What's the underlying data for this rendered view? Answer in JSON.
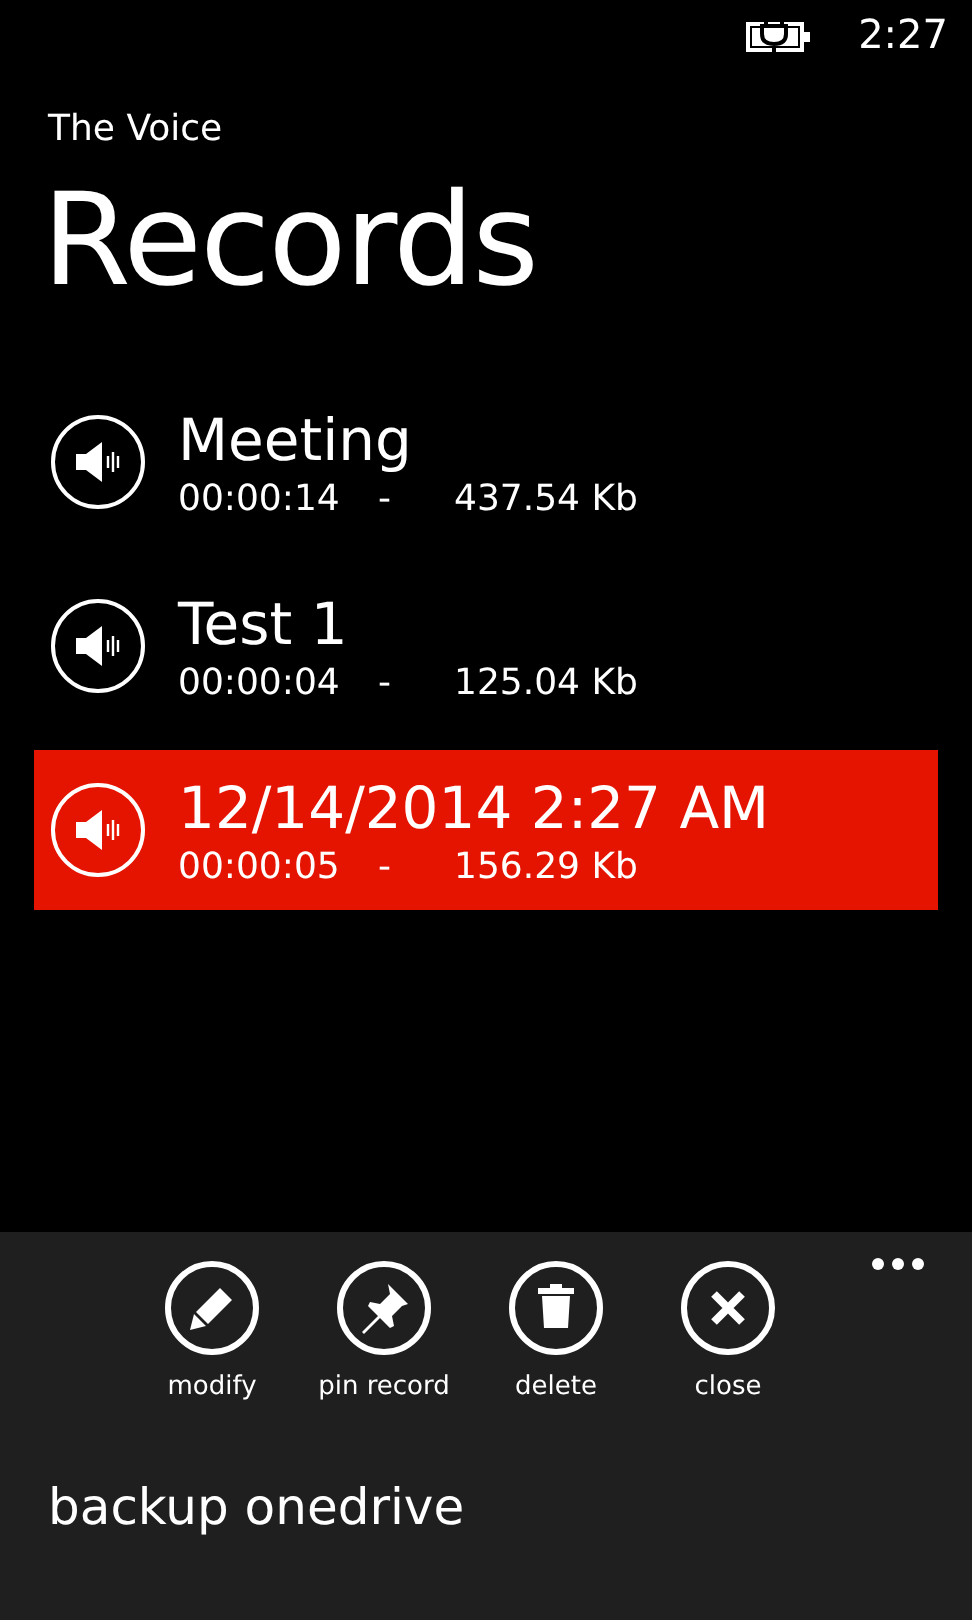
{
  "status_bar": {
    "time": "2:27"
  },
  "app_title": "The Voice",
  "page_title": "Records",
  "records": [
    {
      "name": "Meeting",
      "duration": "00:00:14",
      "separator": "-",
      "size": "437.54 Kb",
      "selected": false
    },
    {
      "name": "Test 1",
      "duration": "00:00:04",
      "separator": "-",
      "size": "125.04 Kb",
      "selected": false
    },
    {
      "name": "12/14/2014 2:27 AM",
      "duration": "00:00:05",
      "separator": "-",
      "size": "156.29 Kb",
      "selected": true
    }
  ],
  "app_bar": {
    "buttons": [
      {
        "kind": "edit",
        "label": "modify"
      },
      {
        "kind": "pin",
        "label": "pin record"
      },
      {
        "kind": "delete",
        "label": "delete"
      },
      {
        "kind": "close",
        "label": "close"
      }
    ],
    "menu_items": [
      "backup onedrive"
    ]
  }
}
